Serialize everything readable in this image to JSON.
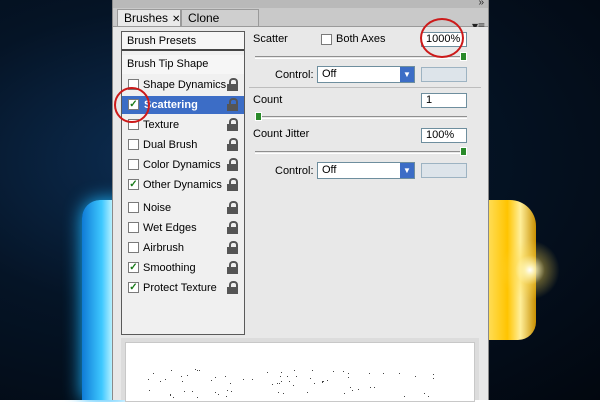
{
  "tabs": {
    "brushes": "Brushes",
    "clone_source": "Clone Source"
  },
  "list": {
    "brush_presets": "Brush Presets",
    "brush_tip_shape": "Brush Tip Shape",
    "items": [
      {
        "label": "Shape Dynamics",
        "checked": false
      },
      {
        "label": "Scattering",
        "checked": true,
        "selected": true
      },
      {
        "label": "Texture",
        "checked": false
      },
      {
        "label": "Dual Brush",
        "checked": false
      },
      {
        "label": "Color Dynamics",
        "checked": false
      },
      {
        "label": "Other Dynamics",
        "checked": true
      },
      {
        "label": "Noise",
        "checked": false
      },
      {
        "label": "Wet Edges",
        "checked": false
      },
      {
        "label": "Airbrush",
        "checked": false
      },
      {
        "label": "Smoothing",
        "checked": true
      },
      {
        "label": "Protect Texture",
        "checked": true
      }
    ]
  },
  "scatter": {
    "label": "Scatter",
    "both_axes_label": "Both Axes",
    "both_axes_checked": false,
    "value": "1000%",
    "slider_fraction": 1.0,
    "control_label": "Control:",
    "control_value": "Off"
  },
  "count": {
    "label": "Count",
    "value": "1",
    "slider_fraction": 0.0
  },
  "count_jitter": {
    "label": "Count Jitter",
    "value": "100%",
    "slider_fraction": 1.0,
    "control_label": "Control:",
    "control_value": "Off"
  },
  "colors": {
    "highlight": "#cc1a1a",
    "selection": "#3c6dc6",
    "slider_thumb": "#2a8a2a"
  }
}
